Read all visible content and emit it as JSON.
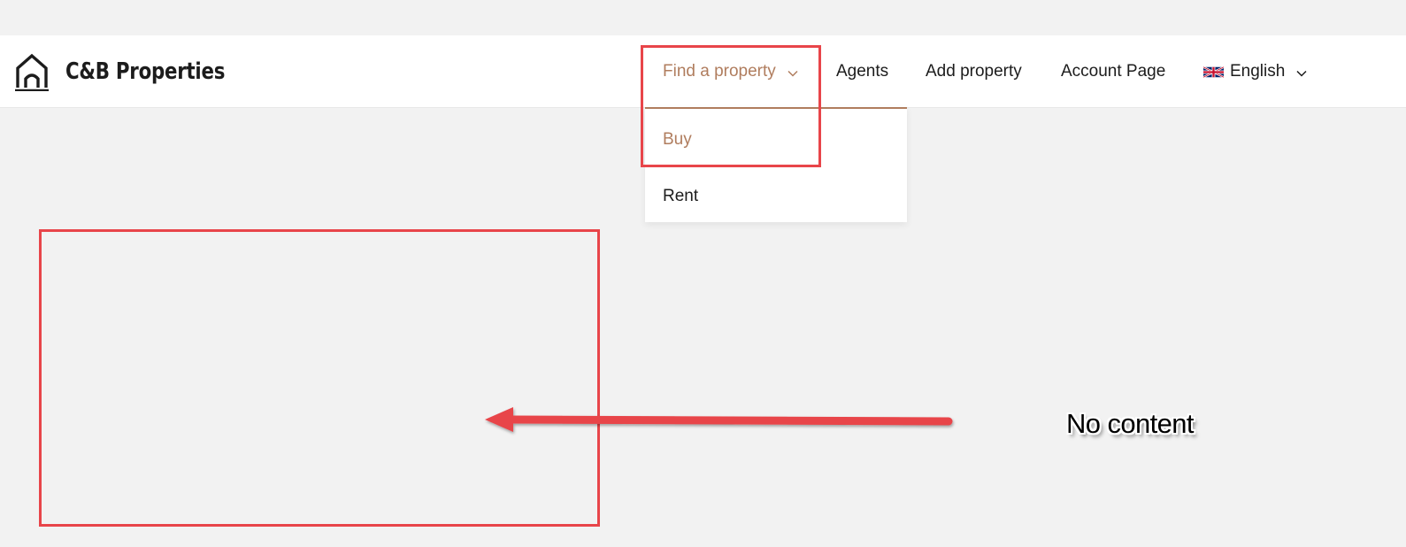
{
  "brand": {
    "name": "C&B Properties",
    "logo_icon": "house-outline-icon"
  },
  "nav": {
    "find_property": "Find a property",
    "agents": "Agents",
    "add_property": "Add property",
    "account_page": "Account Page",
    "language": "English",
    "language_flag_icon": "uk-flag-icon",
    "chevron_icon": "chevron-down-icon"
  },
  "dropdown": {
    "items": [
      {
        "label": "Buy",
        "active": true
      },
      {
        "label": "Rent",
        "active": false
      }
    ]
  },
  "annotation": {
    "label": "No content",
    "color": "#e8454a"
  },
  "colors": {
    "accent": "#b07d5e",
    "background": "#f2f2f2",
    "navbar": "#ffffff",
    "text": "#1c1c1c"
  }
}
